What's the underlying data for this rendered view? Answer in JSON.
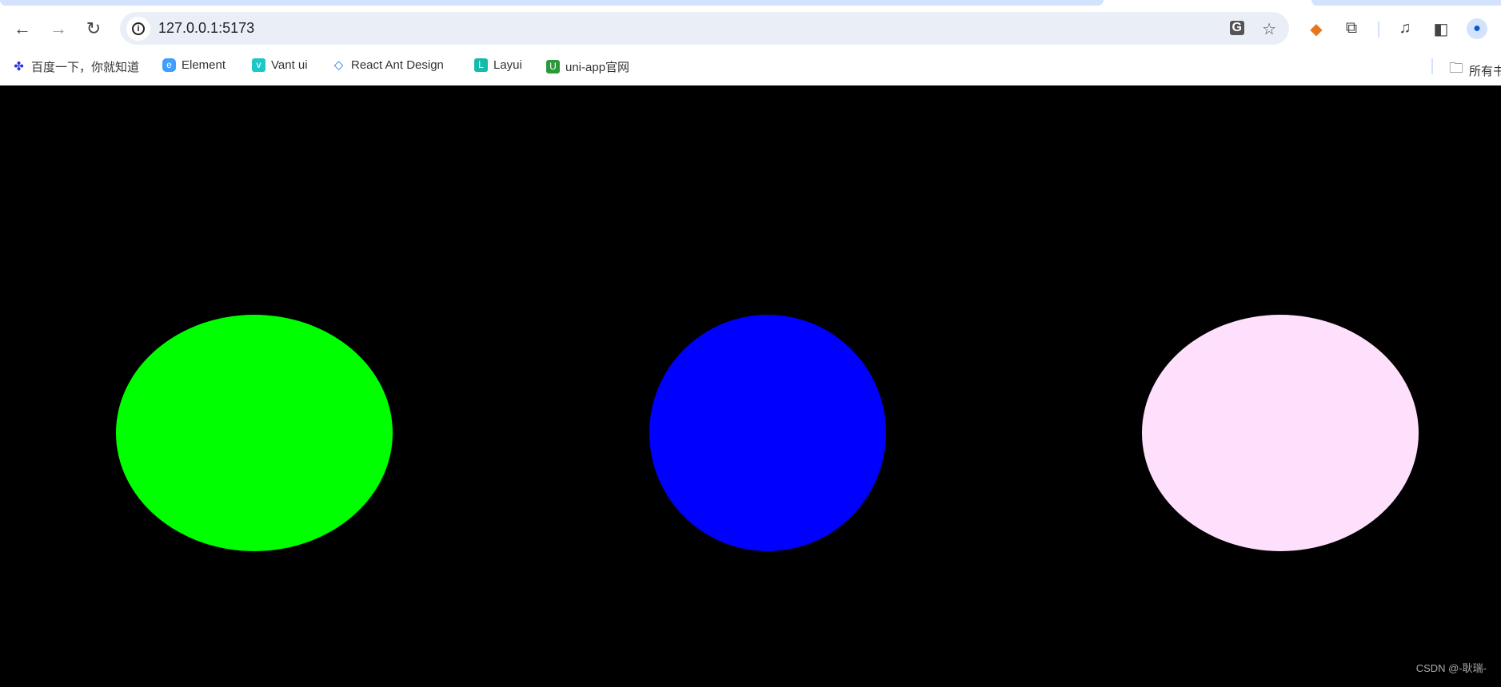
{
  "browser": {
    "url": "127.0.0.1:5173",
    "bookmarks": [
      {
        "label": "百度一下，你就知道",
        "icon": "baidu-icon",
        "color": "#2932e1"
      },
      {
        "label": "Element",
        "icon": "element-icon",
        "color": "#409eff"
      },
      {
        "label": "Vant ui",
        "icon": "vant-icon",
        "color": "#1fc8c8"
      },
      {
        "label": "React Ant Design",
        "icon": "antd-icon",
        "color": "#1677ff"
      },
      {
        "label": "Layui",
        "icon": "layui-icon",
        "color": "#16baaa"
      },
      {
        "label": "uni-app官网",
        "icon": "uniapp-icon",
        "color": "#2b9939"
      }
    ],
    "all_bookmarks_label": "所有书签"
  },
  "canvas": {
    "background": "#000000",
    "shapes": [
      {
        "type": "ellipse",
        "color": "#00ff00"
      },
      {
        "type": "circle",
        "color": "#0000ff"
      },
      {
        "type": "ellipse",
        "color": "#ffe0fc"
      }
    ]
  },
  "watermark": "CSDN @-耿瑞-"
}
